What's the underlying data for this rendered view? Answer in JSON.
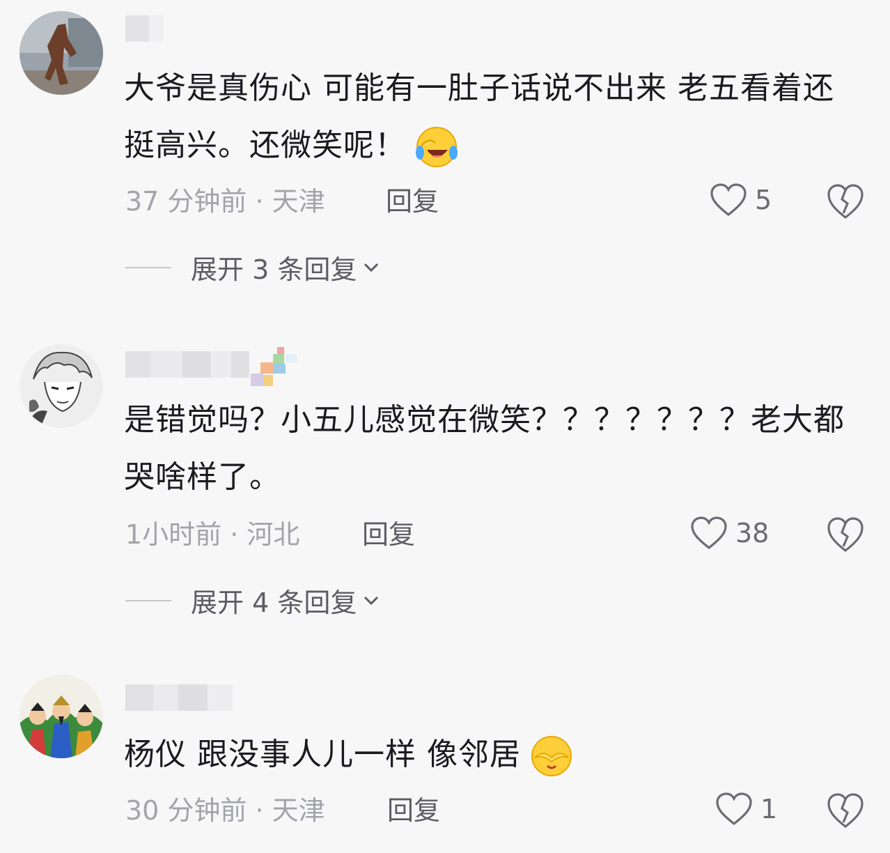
{
  "comments": [
    {
      "text": "大爷是真伤心 可能有一肚子话说不出来 老五看着还挺高兴。还微笑呢！",
      "emoji": "laughing-tears-emoji",
      "time_location": "37 分钟前 · 天津",
      "reply_label": "回复",
      "likes": "5",
      "expand_label": "展开 3 条回复",
      "avatar_icon": "avatar-statue-photo"
    },
    {
      "text": "是错觉吗？小五儿感觉在微笑？？？？？？？老大都哭啥样了。",
      "time_location": "1小时前 · 河北",
      "reply_label": "回复",
      "likes": "38",
      "expand_label": "展开 4 条回复",
      "avatar_icon": "avatar-anime-sketch"
    },
    {
      "text": "杨仪 跟没事人儿一样 像邻居",
      "emoji": "covering-face-emoji",
      "time_location": "30 分钟前 · 天津",
      "reply_label": "回复",
      "likes": "1",
      "avatar_icon": "avatar-opera-figures"
    }
  ],
  "colors": {
    "background": "#f7f7f8",
    "text": "#1b1b1f",
    "meta": "#a3a3aa",
    "icon": "#6b6b72"
  }
}
